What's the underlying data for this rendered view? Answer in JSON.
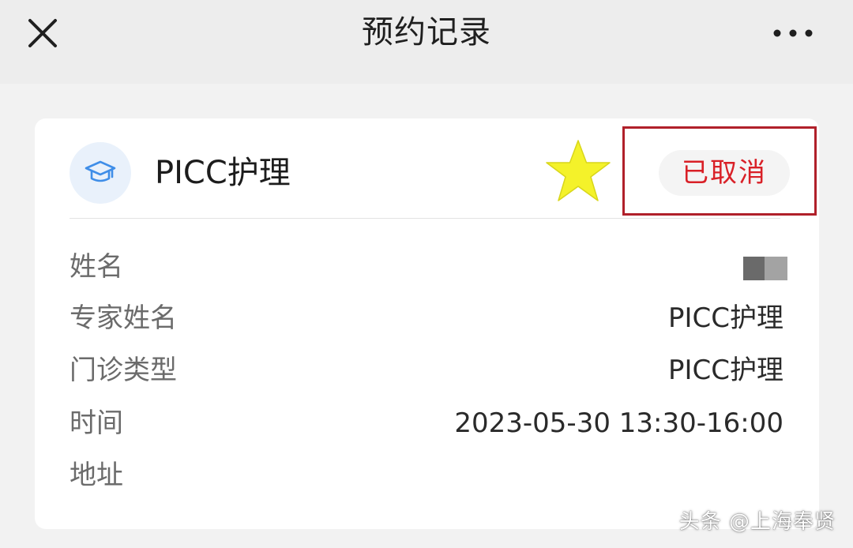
{
  "header": {
    "title": "预约记录",
    "close_icon": "close-icon",
    "more_icon": "more-icon"
  },
  "record": {
    "department_icon": "graduation-cap-icon",
    "department": "PICC护理",
    "status": "已取消",
    "status_color": "#d92027",
    "highlight_color": "#b0202a",
    "star_color": "#f4f22a",
    "fields": [
      {
        "label": "姓名",
        "value": ""
      },
      {
        "label": "专家姓名",
        "value": "PICC护理"
      },
      {
        "label": "门诊类型",
        "value": "PICC护理"
      },
      {
        "label": "时间",
        "value": "2023-05-30 13:30-16:00"
      },
      {
        "label": "地址",
        "value": ""
      }
    ]
  },
  "watermark": "头条 @上海奉贤"
}
